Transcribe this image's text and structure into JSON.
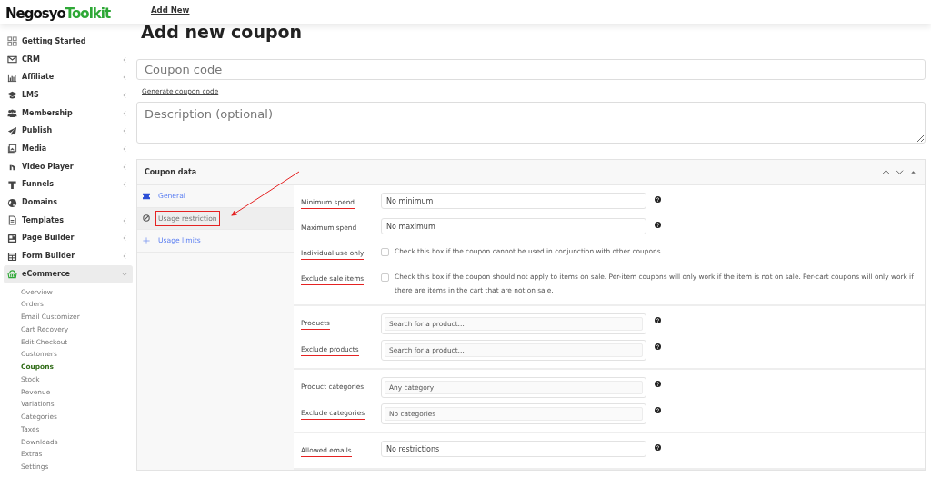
{
  "logo": {
    "text": "Negosyo",
    "accent": "Toolkit"
  },
  "topbar": {
    "link": "Add New"
  },
  "sidebar": {
    "items": [
      {
        "label": "Getting Started",
        "submenu": false,
        "expanded": false
      },
      {
        "label": "CRM",
        "submenu": true,
        "expanded": false
      },
      {
        "label": "Affiliate",
        "submenu": true,
        "expanded": false
      },
      {
        "label": "LMS",
        "submenu": true,
        "expanded": false
      },
      {
        "label": "Membership",
        "submenu": true,
        "expanded": false
      },
      {
        "label": "Publish",
        "submenu": true,
        "expanded": false
      },
      {
        "label": "Media",
        "submenu": true,
        "expanded": false
      },
      {
        "label": "Video Player",
        "submenu": true,
        "expanded": false
      },
      {
        "label": "Funnels",
        "submenu": true,
        "expanded": false
      },
      {
        "label": "Domains",
        "submenu": false,
        "expanded": false
      },
      {
        "label": "Templates",
        "submenu": true,
        "expanded": false
      },
      {
        "label": "Page Builder",
        "submenu": true,
        "expanded": false
      },
      {
        "label": "Form Builder",
        "submenu": true,
        "expanded": false
      },
      {
        "label": "eCommerce",
        "submenu": true,
        "expanded": true,
        "children": [
          {
            "label": "Overview",
            "selected": false
          },
          {
            "label": "Orders",
            "selected": false
          },
          {
            "label": "Email Customizer",
            "selected": false
          },
          {
            "label": "Cart Recovery",
            "selected": false
          },
          {
            "label": "Edit Checkout",
            "selected": false
          },
          {
            "label": "Customers",
            "selected": false
          },
          {
            "label": "Coupons",
            "selected": true
          },
          {
            "label": "Stock",
            "selected": false
          },
          {
            "label": "Revenue",
            "selected": false
          },
          {
            "label": "Variations",
            "selected": false
          },
          {
            "label": "Categories",
            "selected": false
          },
          {
            "label": "Taxes",
            "selected": false
          },
          {
            "label": "Downloads",
            "selected": false
          },
          {
            "label": "Extras",
            "selected": false
          },
          {
            "label": "Settings",
            "selected": false
          }
        ]
      }
    ]
  },
  "page": {
    "title": "Add new coupon",
    "coupon_code": {
      "placeholder": "Coupon code"
    },
    "generate_link": "Generate coupon code",
    "description": {
      "placeholder": "Description (optional)"
    }
  },
  "coupon_data": {
    "title": "Coupon data",
    "tabs": [
      {
        "label": "General",
        "selected": false,
        "highlighted": false
      },
      {
        "label": "Usage restriction",
        "selected": true,
        "highlighted": true
      },
      {
        "label": "Usage limits",
        "selected": false,
        "highlighted": false
      }
    ],
    "groups": [
      [
        {
          "kind": "text",
          "label": "Minimum spend",
          "placeholder": "No minimum",
          "highlighted": true
        },
        {
          "kind": "text",
          "label": "Maximum spend",
          "placeholder": "No maximum",
          "highlighted": true
        },
        {
          "kind": "checkbox",
          "label": "Individual use only",
          "checked": false,
          "description": "Check this box if the coupon cannot be used in conjunction with other coupons.",
          "highlighted": true
        },
        {
          "kind": "checkbox",
          "label": "Exclude sale items",
          "checked": false,
          "description": "Check this box if the coupon should not apply to items on sale. Per-item coupons will only work if the item is not on sale. Per-cart coupons will only work if there are items in the cart that are not on sale.",
          "highlighted": true
        }
      ],
      [
        {
          "kind": "select",
          "label": "Products",
          "placeholder": "Search for a product…",
          "highlighted": true
        },
        {
          "kind": "select",
          "label": "Exclude products",
          "placeholder": "Search for a product…",
          "highlighted": true
        }
      ],
      [
        {
          "kind": "select",
          "label": "Product categories",
          "placeholder": "Any category",
          "highlighted": true
        },
        {
          "kind": "select",
          "label": "Exclude categories",
          "placeholder": "No categories",
          "highlighted": true
        }
      ],
      [
        {
          "kind": "text",
          "label": "Allowed emails",
          "placeholder": "No restrictions",
          "highlighted": true
        }
      ]
    ]
  }
}
